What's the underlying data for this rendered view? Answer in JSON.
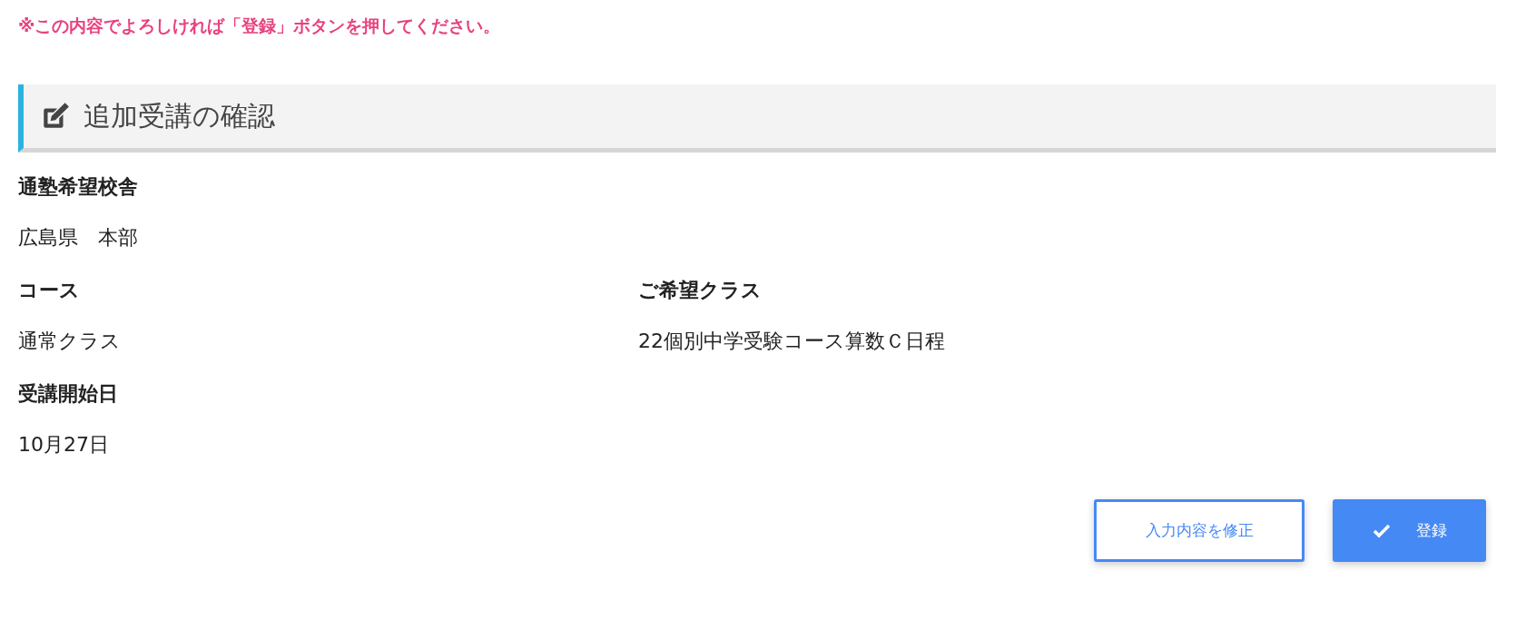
{
  "notice": "※この内容でよろしければ「登録」ボタンを押してください。",
  "section": {
    "title": "追加受講の確認"
  },
  "fields": [
    {
      "label": "通塾希望校舎",
      "value": "広島県　本部"
    },
    {
      "label": "コース",
      "value": "通常クラス"
    },
    {
      "label": "ご希望クラス",
      "value": "22個別中学受験コース算数Ｃ日程"
    },
    {
      "label": "受講開始日",
      "value": "10月27日"
    }
  ],
  "buttons": [
    {
      "label": "入力内容を修正",
      "kind": "secondary"
    },
    {
      "label": "登録",
      "kind": "primary"
    }
  ]
}
